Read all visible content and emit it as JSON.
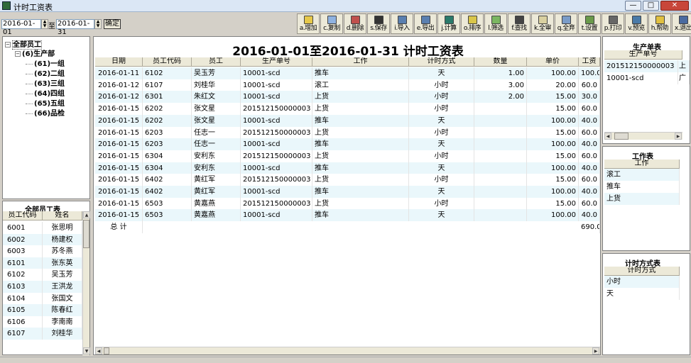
{
  "window": {
    "title": "计时工资表",
    "min": "0",
    "max": "1",
    "close": "r"
  },
  "filter": {
    "start_date": "2016-01-01",
    "to_label": "至",
    "end_date": "2016-01-31",
    "ok_label": "确定"
  },
  "toolbar": [
    {
      "label": "a.增加",
      "icon": "add-icon",
      "color": "#e6c84a"
    },
    {
      "label": "c.复制",
      "icon": "copy-icon",
      "color": "#8fb2e0"
    },
    {
      "label": "d.删除",
      "icon": "delete-icon",
      "color": "#c0504d"
    },
    {
      "label": "s.保存",
      "icon": "save-icon",
      "color": "#333333"
    },
    {
      "label": "i.导入",
      "icon": "import-icon",
      "color": "#5a7fb0"
    },
    {
      "label": "e.导出",
      "icon": "export-icon",
      "color": "#5a7fb0"
    },
    {
      "label": "j.计算",
      "icon": "calculate-icon",
      "color": "#2a7a6a"
    },
    {
      "label": "o.排序",
      "icon": "sort-icon",
      "color": "#d9c64a"
    },
    {
      "label": "l.筛选",
      "icon": "filter-icon",
      "color": "#7bb661"
    },
    {
      "label": "f.查找",
      "icon": "find-icon",
      "color": "#444444"
    },
    {
      "label": "k.全审",
      "icon": "approve-all-icon",
      "color": "#d9d0a0"
    },
    {
      "label": "q.全弃",
      "icon": "discard-all-icon",
      "color": "#7a9cc8"
    },
    {
      "label": "t.设置",
      "icon": "settings-icon",
      "color": "#6a9a4a"
    },
    {
      "label": "p.打印",
      "icon": "print-icon",
      "color": "#666666"
    },
    {
      "label": "v.预览",
      "icon": "preview-icon",
      "color": "#4a7aa8"
    },
    {
      "label": "h.帮助",
      "icon": "help-icon",
      "color": "#e0c040"
    },
    {
      "label": "x.退出",
      "icon": "exit-icon",
      "color": "#4a6aa0"
    }
  ],
  "tree": {
    "root": "全部员工",
    "group": "(6)生产部",
    "children": [
      "(61)一组",
      "(62)二组",
      "(63)三组",
      "(64)四组",
      "(65)五组",
      "(66)品检"
    ]
  },
  "employees": {
    "title": "全部员工表",
    "headers": [
      "员工代码",
      "姓名"
    ],
    "rows": [
      [
        "6001",
        "张思明"
      ],
      [
        "6002",
        "杨建权"
      ],
      [
        "6003",
        "苏冬燕"
      ],
      [
        "6101",
        "张东英"
      ],
      [
        "6102",
        "吴玉芳"
      ],
      [
        "6103",
        "王洪龙"
      ],
      [
        "6104",
        "张国文"
      ],
      [
        "6105",
        "陈春红"
      ],
      [
        "6106",
        "李南南"
      ],
      [
        "6107",
        "刘桂华"
      ]
    ]
  },
  "main": {
    "title": "2016-01-01至2016-01-31 计时工资表",
    "headers": [
      "日期",
      "员工代码",
      "员工",
      "生产单号",
      "工作",
      "计时方式",
      "数量",
      "单价",
      "工资"
    ],
    "rows": [
      [
        "2016-01-11",
        "6102",
        "吴玉芳",
        "10001-scd",
        "推车",
        "天",
        "1.00",
        "100.00",
        "100.0"
      ],
      [
        "2016-01-12",
        "6107",
        "刘桂华",
        "10001-scd",
        "滚工",
        "小时",
        "3.00",
        "20.00",
        "60.0"
      ],
      [
        "2016-01-12",
        "6301",
        "朱红文",
        "10001-scd",
        "上货",
        "小时",
        "2.00",
        "15.00",
        "30.0"
      ],
      [
        "2016-01-15",
        "6202",
        "张文星",
        "201512150000003",
        "上货",
        "小时",
        "",
        "15.00",
        "60.0"
      ],
      [
        "2016-01-15",
        "6202",
        "张文星",
        "10001-scd",
        "推车",
        "天",
        "",
        "100.00",
        "40.0"
      ],
      [
        "2016-01-15",
        "6203",
        "任志一",
        "201512150000003",
        "上货",
        "小时",
        "",
        "15.00",
        "60.0"
      ],
      [
        "2016-01-15",
        "6203",
        "任志一",
        "10001-scd",
        "推车",
        "天",
        "",
        "100.00",
        "40.0"
      ],
      [
        "2016-01-15",
        "6304",
        "安利东",
        "201512150000003",
        "上货",
        "小时",
        "",
        "15.00",
        "60.0"
      ],
      [
        "2016-01-15",
        "6304",
        "安利东",
        "10001-scd",
        "推车",
        "天",
        "",
        "100.00",
        "40.0"
      ],
      [
        "2016-01-15",
        "6402",
        "黄红军",
        "201512150000003",
        "上货",
        "小时",
        "",
        "15.00",
        "60.0"
      ],
      [
        "2016-01-15",
        "6402",
        "黄红军",
        "10001-scd",
        "推车",
        "天",
        "",
        "100.00",
        "40.0"
      ],
      [
        "2016-01-15",
        "6503",
        "黄嘉燕",
        "201512150000003",
        "上货",
        "小时",
        "",
        "15.00",
        "60.0"
      ],
      [
        "2016-01-15",
        "6503",
        "黄嘉燕",
        "10001-scd",
        "推车",
        "天",
        "",
        "100.00",
        "40.0"
      ]
    ],
    "total_label": "总  计",
    "total_value": "690.0"
  },
  "orders": {
    "title": "生产单表",
    "header": "生产单号",
    "rows": [
      [
        "201512150000003",
        "上"
      ],
      [
        "10001-scd",
        "广"
      ]
    ]
  },
  "jobs": {
    "title": "工作表",
    "header": "工作",
    "rows": [
      "滚工",
      "推车",
      "上货"
    ]
  },
  "timing": {
    "title": "计时方式表",
    "header": "计时方式",
    "rows": [
      "小时",
      "天"
    ]
  }
}
